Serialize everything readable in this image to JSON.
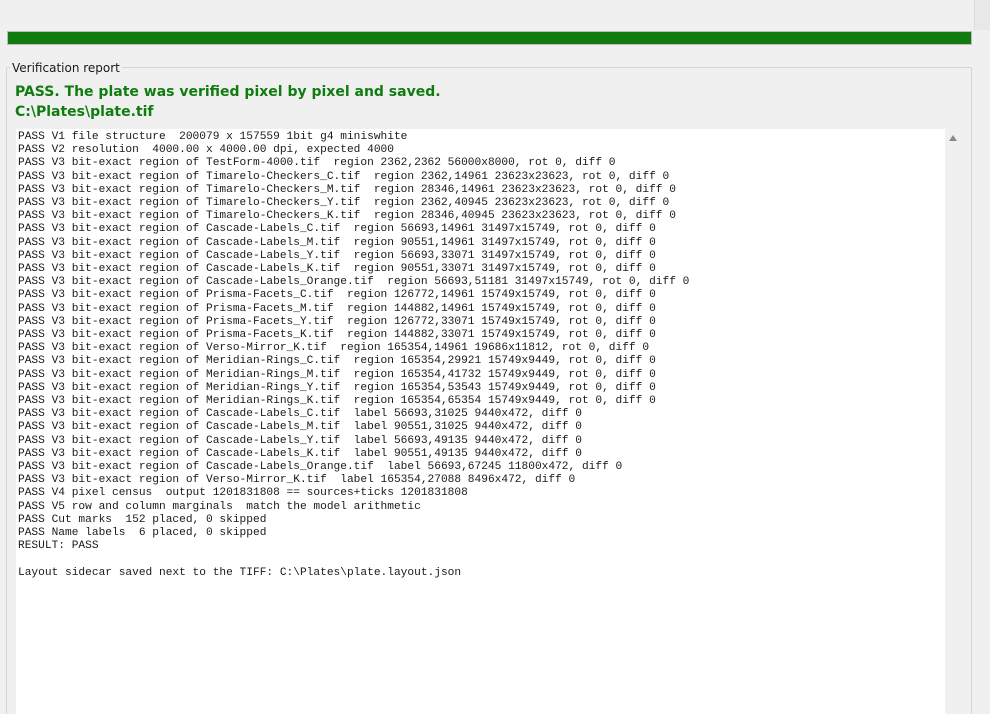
{
  "progress": {
    "value_percent": 100,
    "color": "#107c10"
  },
  "group": {
    "title": "Verification report"
  },
  "status": {
    "message": "PASS. The plate was verified pixel by pixel and saved.",
    "path": "C:\\Plates\\plate.tif",
    "color": "#107c10"
  },
  "report": {
    "lines": [
      "PASS V1 file structure  200079 x 157559 1bit g4 miniswhite",
      "PASS V2 resolution  4000.00 x 4000.00 dpi, expected 4000",
      "PASS V3 bit-exact region of TestForm-4000.tif  region 2362,2362 56000x8000, rot 0, diff 0",
      "PASS V3 bit-exact region of Timarelo-Checkers_C.tif  region 2362,14961 23623x23623, rot 0, diff 0",
      "PASS V3 bit-exact region of Timarelo-Checkers_M.tif  region 28346,14961 23623x23623, rot 0, diff 0",
      "PASS V3 bit-exact region of Timarelo-Checkers_Y.tif  region 2362,40945 23623x23623, rot 0, diff 0",
      "PASS V3 bit-exact region of Timarelo-Checkers_K.tif  region 28346,40945 23623x23623, rot 0, diff 0",
      "PASS V3 bit-exact region of Cascade-Labels_C.tif  region 56693,14961 31497x15749, rot 0, diff 0",
      "PASS V3 bit-exact region of Cascade-Labels_M.tif  region 90551,14961 31497x15749, rot 0, diff 0",
      "PASS V3 bit-exact region of Cascade-Labels_Y.tif  region 56693,33071 31497x15749, rot 0, diff 0",
      "PASS V3 bit-exact region of Cascade-Labels_K.tif  region 90551,33071 31497x15749, rot 0, diff 0",
      "PASS V3 bit-exact region of Cascade-Labels_Orange.tif  region 56693,51181 31497x15749, rot 0, diff 0",
      "PASS V3 bit-exact region of Prisma-Facets_C.tif  region 126772,14961 15749x15749, rot 0, diff 0",
      "PASS V3 bit-exact region of Prisma-Facets_M.tif  region 144882,14961 15749x15749, rot 0, diff 0",
      "PASS V3 bit-exact region of Prisma-Facets_Y.tif  region 126772,33071 15749x15749, rot 0, diff 0",
      "PASS V3 bit-exact region of Prisma-Facets_K.tif  region 144882,33071 15749x15749, rot 0, diff 0",
      "PASS V3 bit-exact region of Verso-Mirror_K.tif  region 165354,14961 19686x11812, rot 0, diff 0",
      "PASS V3 bit-exact region of Meridian-Rings_C.tif  region 165354,29921 15749x9449, rot 0, diff 0",
      "PASS V3 bit-exact region of Meridian-Rings_M.tif  region 165354,41732 15749x9449, rot 0, diff 0",
      "PASS V3 bit-exact region of Meridian-Rings_Y.tif  region 165354,53543 15749x9449, rot 0, diff 0",
      "PASS V3 bit-exact region of Meridian-Rings_K.tif  region 165354,65354 15749x9449, rot 0, diff 0",
      "PASS V3 bit-exact region of Cascade-Labels_C.tif  label 56693,31025 9440x472, diff 0",
      "PASS V3 bit-exact region of Cascade-Labels_M.tif  label 90551,31025 9440x472, diff 0",
      "PASS V3 bit-exact region of Cascade-Labels_Y.tif  label 56693,49135 9440x472, diff 0",
      "PASS V3 bit-exact region of Cascade-Labels_K.tif  label 90551,49135 9440x472, diff 0",
      "PASS V3 bit-exact region of Cascade-Labels_Orange.tif  label 56693,67245 11800x472, diff 0",
      "PASS V3 bit-exact region of Verso-Mirror_K.tif  label 165354,27088 8496x472, diff 0",
      "PASS V4 pixel census  output 1201831808 == sources+ticks 1201831808",
      "PASS V5 row and column marginals  match the model arithmetic",
      "PASS Cut marks  152 placed, 0 skipped",
      "PASS Name labels  6 placed, 0 skipped",
      "RESULT: PASS",
      "",
      "Layout sidecar saved next to the TIFF: C:\\Plates\\plate.layout.json"
    ]
  }
}
